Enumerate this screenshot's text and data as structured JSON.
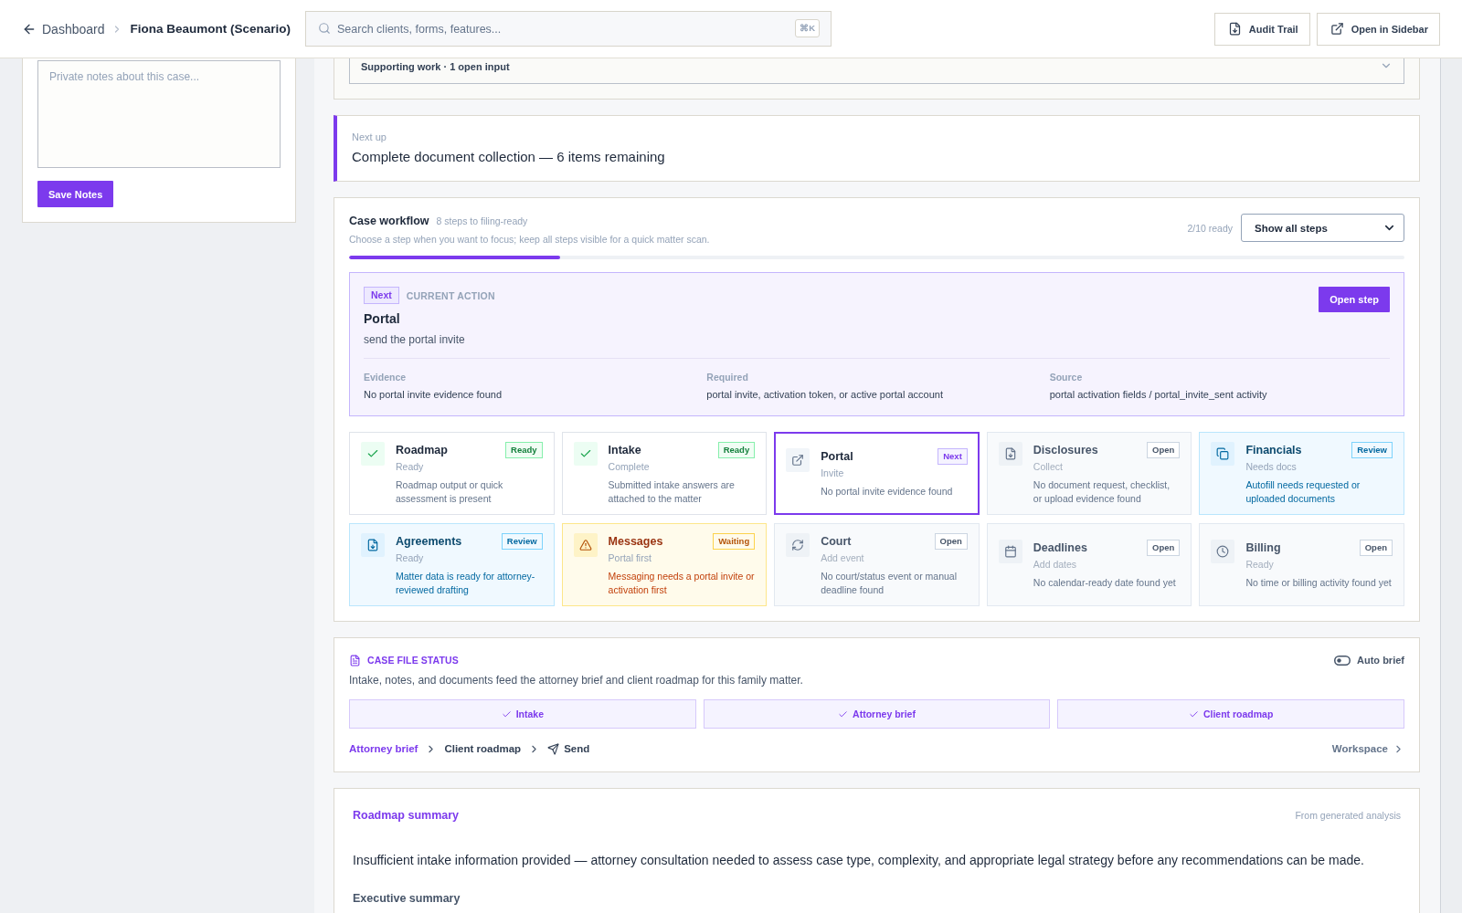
{
  "header": {
    "back": "Dashboard",
    "title": "Fiona Beaumont (Scenario)",
    "search": {
      "placeholder": "Search clients, forms, features...",
      "shortcut": "⌘K"
    },
    "actions": [
      "Audit Trail",
      "Open in Sidebar"
    ]
  },
  "notes": {
    "placeholder": "Private notes about this case...",
    "button": "Save Notes"
  },
  "supporting_work": {
    "label": "Supporting work · 1 open input",
    "expanded": false
  },
  "next_up": {
    "label": "Next up",
    "title": "Complete document collection — 6 items remaining"
  },
  "workflow": {
    "title": "Case workflow",
    "subtitle": "8 steps to filing-ready",
    "hint": "Choose a step when you want to focus; keep all steps visible for a quick matter scan.",
    "ready_count": "2/10 ready",
    "filter": "Show all steps",
    "level": 0.2,
    "current_action": {
      "badge": "Next",
      "label": "CURRENT ACTION",
      "title": "Portal",
      "description": "send the portal invite",
      "button": "Open step",
      "details": [
        {
          "label": "Evidence",
          "value": "No portal invite evidence found"
        },
        {
          "label": "Required",
          "value": "portal invite, activation token, or active portal account"
        },
        {
          "label": "Source",
          "value": "portal activation fields / portal_invite_sent activity"
        }
      ]
    },
    "steps": [
      {
        "kind": "ready",
        "title": "Roadmap",
        "status": "Ready",
        "badge": "Ready",
        "description": "Roadmap output or quick assessment is present"
      },
      {
        "kind": "ready",
        "title": "Intake",
        "status": "Complete",
        "badge": "Ready",
        "description": "Submitted intake answers are attached to the matter"
      },
      {
        "kind": "next",
        "title": "Portal",
        "status": "Invite",
        "badge": "Next",
        "description": "No portal invite evidence found"
      },
      {
        "kind": "open",
        "title": "Disclosures",
        "status": "Collect",
        "badge": "Open",
        "description": "No document request, checklist, or upload evidence found"
      },
      {
        "kind": "review",
        "title": "Financials",
        "status": "Needs docs",
        "badge": "Review",
        "description": "Autofill needs requested or uploaded documents"
      },
      {
        "kind": "review",
        "title": "Agreements",
        "status": "Ready",
        "badge": "Review",
        "description": "Matter data is ready for attorney-reviewed drafting"
      },
      {
        "kind": "waiting",
        "title": "Messages",
        "status": "Portal first",
        "badge": "Waiting",
        "description": "Messaging needs a portal invite or activation first"
      },
      {
        "kind": "open",
        "title": "Court",
        "status": "Add event",
        "badge": "Open",
        "description": "No court/status event or manual deadline found"
      },
      {
        "kind": "open",
        "title": "Deadlines",
        "status": "Add dates",
        "badge": "Open",
        "description": "No calendar-ready date found yet"
      },
      {
        "kind": "open",
        "title": "Billing",
        "status": "Ready",
        "badge": "Open",
        "description": "No time or billing activity found yet"
      }
    ]
  },
  "case_file_status": {
    "title": "CASE FILE STATUS",
    "auto_brief": {
      "label": "Auto brief",
      "on": false
    },
    "description": "Intake, notes, and documents feed the attorney brief and client roadmap for this family matter.",
    "stages": [
      {
        "label": "Intake",
        "done": true
      },
      {
        "label": "Attorney brief",
        "done": true
      },
      {
        "label": "Client roadmap",
        "done": true
      }
    ],
    "path": [
      {
        "kind": "link",
        "label": "Attorney brief",
        "selected": true
      },
      {
        "kind": "link",
        "label": "Client roadmap",
        "selected": false
      },
      {
        "kind": "action",
        "label": "Send",
        "selected": false
      }
    ],
    "workspace": "Workspace"
  },
  "roadmap_summary": {
    "title": "Roadmap summary",
    "source": "From generated analysis",
    "text": "Insufficient intake information provided — attorney consultation needed to assess case type, complexity, and appropriate legal strategy before any recommendations can be made.",
    "section": "Executive summary"
  }
}
